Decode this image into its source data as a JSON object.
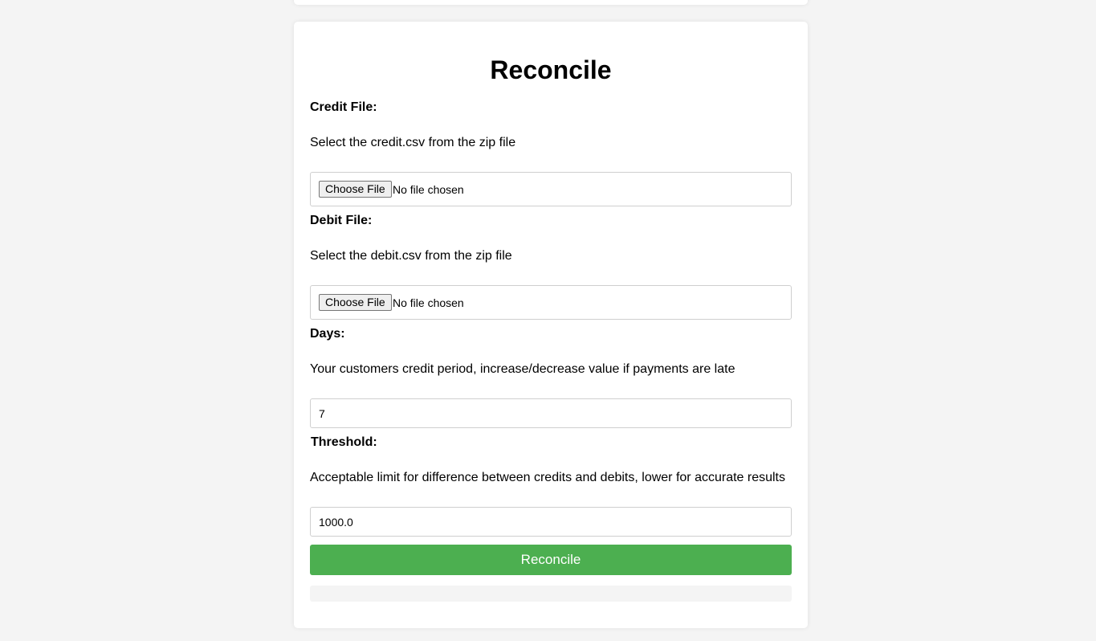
{
  "form": {
    "title": "Reconcile",
    "credit": {
      "label": "Credit File:",
      "description": "Select the credit.csv from the zip file",
      "button": "Choose File",
      "status": "No file chosen"
    },
    "debit": {
      "label": "Debit File:",
      "description": "Select the debit.csv from the zip file",
      "button": "Choose File",
      "status": "No file chosen"
    },
    "days": {
      "label": "Days:",
      "description": "Your customers credit period, increase/decrease value if payments are late",
      "value": "7"
    },
    "threshold": {
      "label": "Threshold:",
      "description": "Acceptable limit for difference between credits and debits, lower for accurate results",
      "value": "1000.0"
    },
    "submit_label": "Reconcile",
    "submit_color": "#4caf50"
  }
}
